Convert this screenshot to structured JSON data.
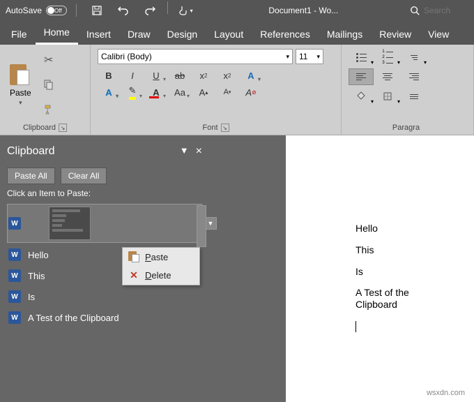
{
  "titlebar": {
    "autosave_label": "AutoSave",
    "autosave_state": "Off",
    "doc_title": "Document1 - Wo...",
    "search_placeholder": "Search"
  },
  "tabs": [
    "File",
    "Home",
    "Insert",
    "Draw",
    "Design",
    "Layout",
    "References",
    "Mailings",
    "Review",
    "View"
  ],
  "active_tab": "Home",
  "ribbon": {
    "clipboard": {
      "group": "Clipboard",
      "paste": "Paste"
    },
    "font": {
      "group": "Font",
      "name": "Calibri (Body)",
      "size": "11"
    },
    "paragraph": {
      "group": "Paragra"
    }
  },
  "pane": {
    "title": "Clipboard",
    "paste_all": "Paste All",
    "clear_all": "Clear All",
    "hint": "Click an Item to Paste:",
    "items": [
      "Hello",
      "This",
      "Is",
      "A Test of the Clipboard"
    ]
  },
  "context_menu": {
    "paste": "aste",
    "paste_u": "P",
    "delete": "elete",
    "delete_u": "D"
  },
  "document": {
    "lines": [
      "Hello",
      "This",
      "Is",
      "A Test of the Clipboard"
    ]
  },
  "watermark": "wsxdn.com"
}
